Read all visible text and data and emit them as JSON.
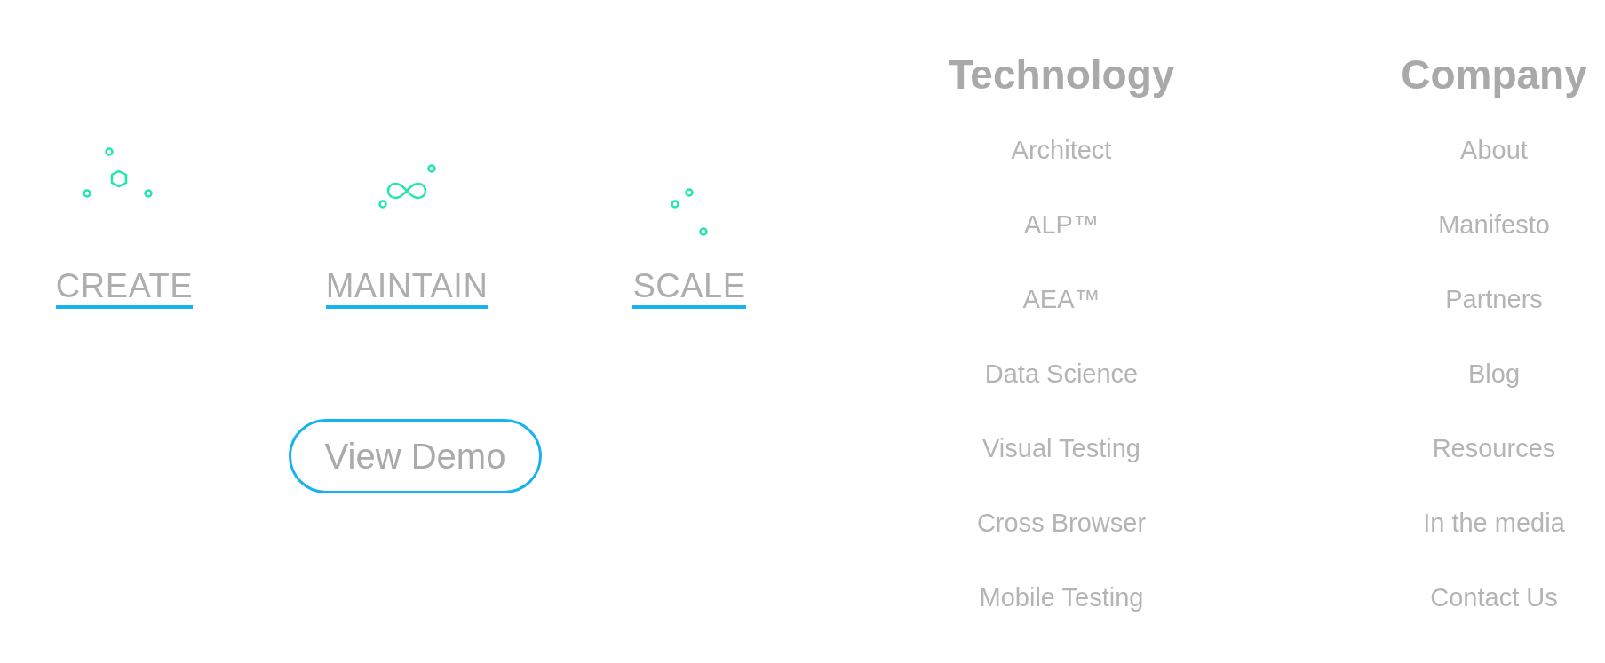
{
  "features": [
    {
      "label": "CREATE"
    },
    {
      "label": "MAINTAIN"
    },
    {
      "label": "SCALE"
    }
  ],
  "demo_button": {
    "label": "View Demo"
  },
  "columns": [
    {
      "heading": "Technology",
      "links": [
        "Architect",
        "ALP™",
        "AEA™",
        "Data Science",
        "Visual Testing",
        "Cross Browser",
        "Mobile Testing"
      ]
    },
    {
      "heading": "Company",
      "links": [
        "About",
        "Manifesto",
        "Partners",
        "Blog",
        "Resources",
        "In the media",
        "Contact Us"
      ]
    }
  ]
}
